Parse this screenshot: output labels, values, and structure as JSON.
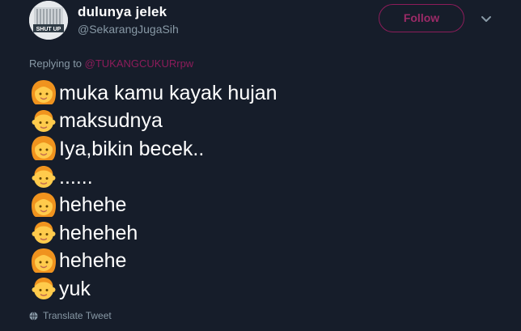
{
  "user": {
    "display_name": "dulunya jelek",
    "handle": "@SekarangJugaSih",
    "avatar_text": "SHUT UP"
  },
  "follow_button": {
    "label": "Follow"
  },
  "reply": {
    "prefix": "Replying to ",
    "mention": "@TUKANGCUKURrpw"
  },
  "tweet_lines": [
    {
      "emoji": "woman-emoji",
      "text": "muka kamu kayak hujan"
    },
    {
      "emoji": "man-emoji",
      "text": "maksudnya"
    },
    {
      "emoji": "woman-emoji",
      "text": "Iya,bikin becek.."
    },
    {
      "emoji": "man-emoji",
      "text": "......"
    },
    {
      "emoji": "woman-emoji",
      "text": "hehehe"
    },
    {
      "emoji": "man-emoji",
      "text": "heheheh"
    },
    {
      "emoji": "woman-emoji",
      "text": "hehehe"
    },
    {
      "emoji": "man-emoji",
      "text": "yuk"
    }
  ],
  "translate": {
    "label": "Translate Tweet"
  },
  "colors": {
    "background": "#161d2a",
    "accent": "#8c1c5a",
    "secondary_text": "#8899a6",
    "emoji_skin": "#ffcb4c",
    "emoji_hair": "#f0931e"
  }
}
